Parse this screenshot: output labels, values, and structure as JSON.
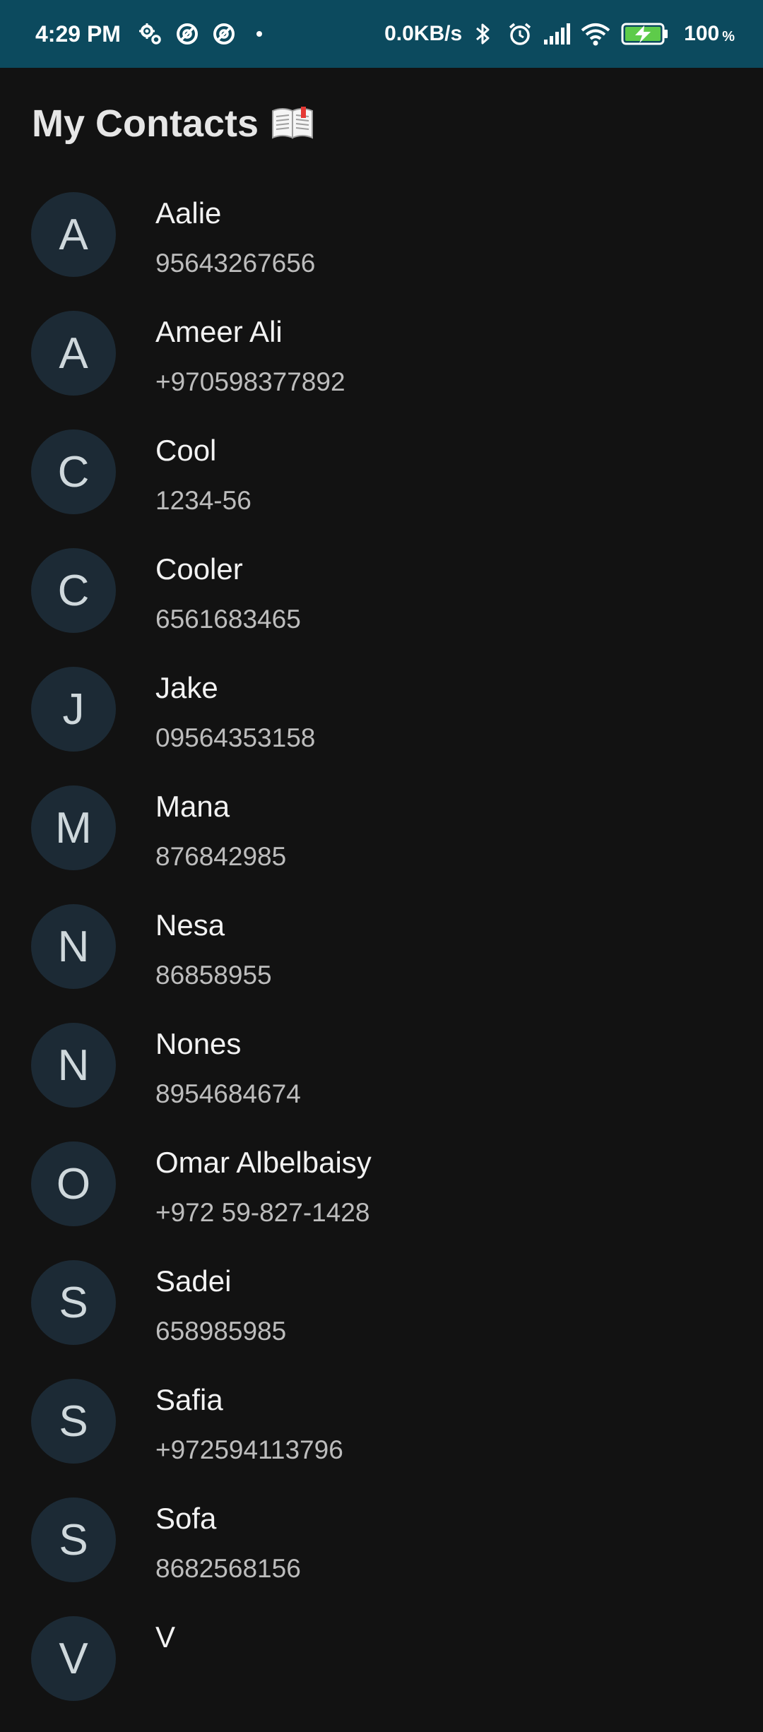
{
  "status_bar": {
    "time": "4:29 PM",
    "net_speed": "0.0KB/s",
    "battery": "100",
    "battery_unit": "%",
    "icons": [
      "settings-gears-icon",
      "data-saver-icon",
      "data-saver-icon",
      "dot-icon",
      "bluetooth-icon",
      "alarm-icon",
      "signal-icon",
      "wifi-icon",
      "battery-charging-icon"
    ]
  },
  "header": {
    "title": "My Contacts",
    "icon": "open-book-icon"
  },
  "contacts": [
    {
      "initial": "A",
      "name": "Aalie",
      "phone": "95643267656"
    },
    {
      "initial": "A",
      "name": "Ameer Ali",
      "phone": "+970598377892"
    },
    {
      "initial": "C",
      "name": "Cool",
      "phone": "1234-56"
    },
    {
      "initial": "C",
      "name": "Cooler",
      "phone": "6561683465"
    },
    {
      "initial": "J",
      "name": "Jake",
      "phone": "09564353158"
    },
    {
      "initial": "M",
      "name": "Mana",
      "phone": "876842985"
    },
    {
      "initial": "N",
      "name": "Nesa",
      "phone": "86858955"
    },
    {
      "initial": "N",
      "name": "Nones",
      "phone": "8954684674"
    },
    {
      "initial": "O",
      "name": "Omar Albelbaisy",
      "phone": "+972 59-827-1428"
    },
    {
      "initial": "S",
      "name": "Sadei",
      "phone": "658985985"
    },
    {
      "initial": "S",
      "name": "Safia",
      "phone": "+972594113796"
    },
    {
      "initial": "S",
      "name": "Sofa",
      "phone": "8682568156"
    },
    {
      "initial": "V",
      "name": "V",
      "phone": ""
    }
  ],
  "colors": {
    "status_bar_bg": "#0c4a5e",
    "page_bg": "#121212",
    "avatar_bg": "#1c2a35"
  }
}
